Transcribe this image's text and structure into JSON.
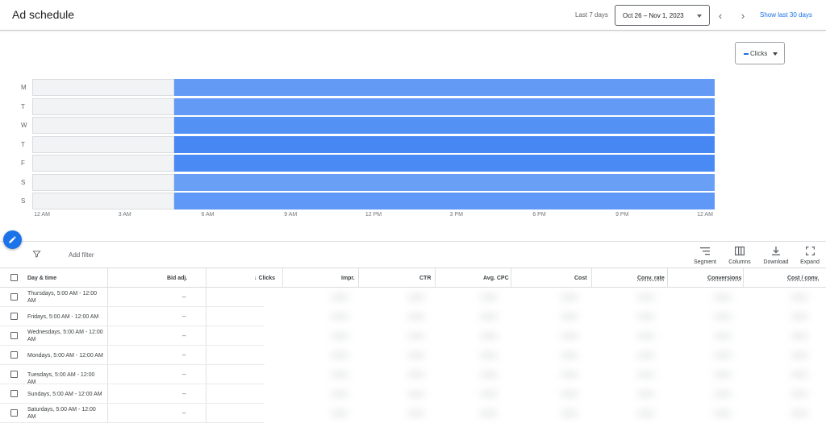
{
  "header": {
    "title": "Ad schedule",
    "range_label": "Last 7 days",
    "date_range": "Oct 26 – Nov 1, 2023",
    "show_last": "Show last 30 days"
  },
  "chart_controls": {
    "metric": "Clicks"
  },
  "chart_data": {
    "type": "heatmap",
    "rows": [
      "M",
      "T",
      "W",
      "T",
      "F",
      "S",
      "S"
    ],
    "x_ticks": [
      "12 AM",
      "3 AM",
      "6 AM",
      "9 AM",
      "12 PM",
      "3 PM",
      "6 PM",
      "9 PM",
      "12 AM"
    ],
    "scheduled_start": "5 AM",
    "scheduled_end": "12 AM",
    "intensity": [
      0.55,
      0.55,
      0.75,
      0.95,
      0.9,
      0.45,
      0.6
    ],
    "colors": {
      "inactive": "#f1f3f4",
      "low": "#8ab4f8",
      "high": "#4285f4"
    }
  },
  "toolbar": {
    "add_filter": "Add filter",
    "segment": "Segment",
    "columns": "Columns",
    "download": "Download",
    "expand": "Expand"
  },
  "table": {
    "headers": {
      "day_time": "Day & time",
      "bid_adj": "Bid adj.",
      "clicks": "Clicks",
      "impr": "Impr.",
      "ctr": "CTR",
      "avg_cpc": "Avg. CPC",
      "cost": "Cost",
      "conv_rate": "Conv. rate",
      "conversions": "Conversions",
      "cost_conv": "Cost / conv."
    },
    "rows": [
      {
        "day": "Thursdays, 5:00 AM - 12:00 AM",
        "bid": "–"
      },
      {
        "day": "Fridays, 5:00 AM - 12:00 AM",
        "bid": "–"
      },
      {
        "day": "Wednesdays, 5:00 AM - 12:00 AM",
        "bid": "–"
      },
      {
        "day": "Mondays, 5:00 AM - 12:00 AM",
        "bid": "–"
      },
      {
        "day": "Tuesdays, 5:00 AM - 12:00 AM",
        "bid": "–"
      },
      {
        "day": "Sundays, 5:00 AM - 12:00 AM",
        "bid": "–"
      },
      {
        "day": "Saturdays, 5:00 AM - 12:00 AM",
        "bid": "–"
      }
    ]
  }
}
